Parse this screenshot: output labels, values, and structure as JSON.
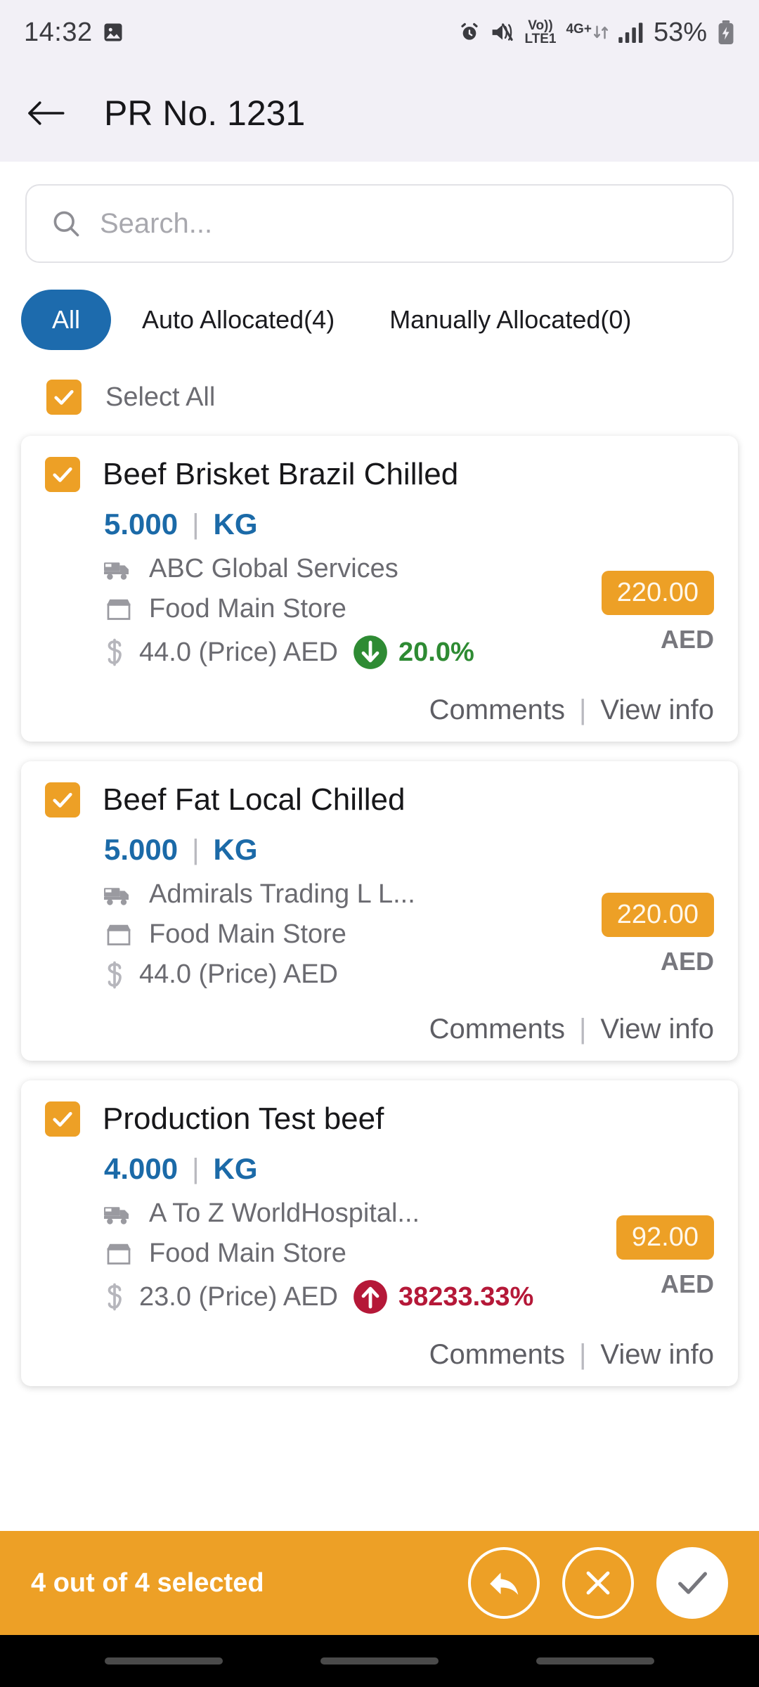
{
  "status_bar": {
    "time": "14:32",
    "left_icons": [
      "image-icon"
    ],
    "right_icons": [
      "alarm-icon",
      "mute-vibrate-icon",
      "volte-icon",
      "network-4gplus-icon",
      "signal-bars-icon"
    ],
    "volte_top": "Vo))",
    "volte_bottom": "LTE1",
    "network": "4G+",
    "battery_percent": "53%"
  },
  "app_bar": {
    "back_icon": "arrow-left-icon",
    "title": "PR No. 1231"
  },
  "search": {
    "placeholder": "Search...",
    "value": "",
    "icon": "search-icon"
  },
  "tabs": [
    {
      "label": "All",
      "active": true
    },
    {
      "label": "Auto Allocated(4)",
      "active": false
    },
    {
      "label": "Manually Allocated(0)",
      "active": false
    }
  ],
  "select_all": {
    "label": "Select All",
    "checked": true
  },
  "colors": {
    "accent_orange": "#eda026",
    "accent_blue": "#1d6bad",
    "qty_blue": "#1b6aa8",
    "down_green": "#2e8b33",
    "up_red": "#b51838",
    "text_grey": "#6b6b71"
  },
  "items": [
    {
      "checked": true,
      "title": "Beef Brisket Brazil Chilled",
      "qty": "5.000",
      "unit": "KG",
      "supplier": "ABC Global Services",
      "store": "Food Main Store",
      "price": "44.0 (Price) AED",
      "change_direction": "down",
      "change_percent": "20.0%",
      "amount": "220.00",
      "currency": "AED",
      "comments_label": "Comments",
      "separator": "|",
      "view_info_label": "View info"
    },
    {
      "checked": true,
      "title": "Beef Fat Local Chilled",
      "qty": "5.000",
      "unit": "KG",
      "supplier": "Admirals Trading L L...",
      "store": "Food Main Store",
      "price": "44.0 (Price) AED",
      "change_direction": "none",
      "change_percent": "",
      "amount": "220.00",
      "currency": "AED",
      "comments_label": "Comments",
      "separator": "|",
      "view_info_label": "View info"
    },
    {
      "checked": true,
      "title": "Production Test beef",
      "qty": "4.000",
      "unit": "KG",
      "supplier": "A To Z WorldHospital...",
      "store": "Food Main Store",
      "price": "23.0 (Price) AED",
      "change_direction": "up",
      "change_percent": "38233.33%",
      "amount": "92.00",
      "currency": "AED",
      "comments_label": "Comments",
      "separator": "|",
      "view_info_label": "View info"
    }
  ],
  "bottom_bar": {
    "status_text": "4 out of 4 selected",
    "actions": [
      {
        "name": "reply-icon"
      },
      {
        "name": "close-icon"
      },
      {
        "name": "check-icon"
      }
    ]
  }
}
